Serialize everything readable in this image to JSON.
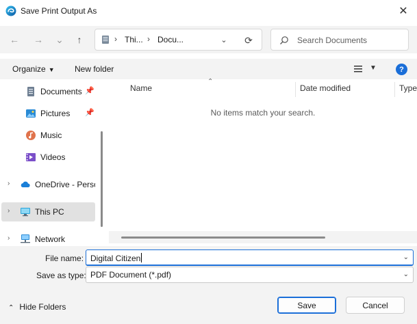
{
  "window": {
    "title": "Save Print Output As",
    "app_icon": "edge-icon",
    "close_label": "✕"
  },
  "nav": {
    "back": "←",
    "forward": "→",
    "recent": "⌄",
    "up": "↑",
    "address": {
      "icon": "pc-icon",
      "crumbs": [
        "Thi...",
        "Docu..."
      ]
    },
    "refresh": "⟳"
  },
  "search": {
    "placeholder": "Search Documents"
  },
  "toolbar": {
    "organize_label": "Organize",
    "new_folder_label": "New folder",
    "help_label": "?"
  },
  "sidebar": {
    "items": [
      {
        "label": "Documents",
        "icon": "documents-icon",
        "pinned": true
      },
      {
        "label": "Pictures",
        "icon": "pictures-icon",
        "pinned": true
      },
      {
        "label": "Music",
        "icon": "music-icon"
      },
      {
        "label": "Videos",
        "icon": "videos-icon"
      },
      {
        "label": "OneDrive - Perso",
        "icon": "onedrive-icon",
        "expandable": true
      },
      {
        "label": "This PC",
        "icon": "pc-icon",
        "expandable": true,
        "selected": true
      },
      {
        "label": "Network",
        "icon": "network-icon",
        "expandable": true
      }
    ]
  },
  "content": {
    "columns": [
      "Name",
      "Date modified",
      "Type"
    ],
    "empty_message": "No items match your search."
  },
  "form": {
    "file_name_label": "File name:",
    "file_name_value": "Digital Citizen",
    "save_as_type_label": "Save as type:",
    "save_as_type_value": "PDF Document (*.pdf)"
  },
  "footer": {
    "hide_folders_label": "Hide Folders",
    "save_label": "Save",
    "cancel_label": "Cancel"
  },
  "colors": {
    "accent": "#1a6ed8",
    "panel": "#f3f3f3",
    "selected": "#e1e1e1"
  }
}
